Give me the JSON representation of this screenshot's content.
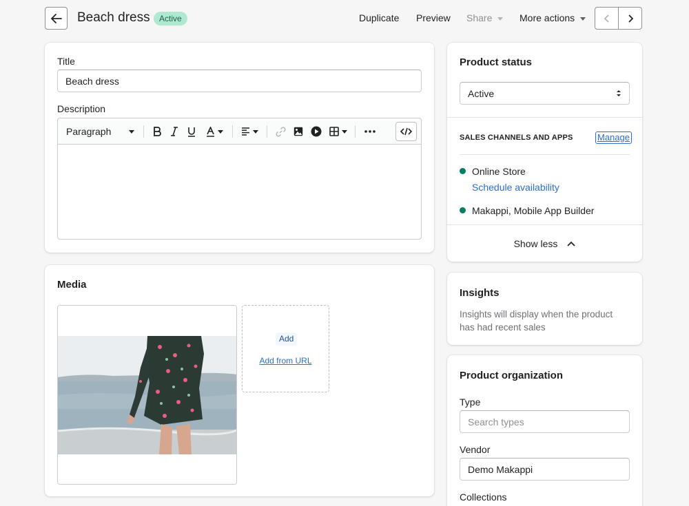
{
  "header": {
    "title": "Beach dress",
    "status_badge": "Active",
    "actions": {
      "duplicate": "Duplicate",
      "preview": "Preview",
      "share": "Share",
      "more": "More actions"
    }
  },
  "product_form": {
    "title_label": "Title",
    "title_value": "Beach dress",
    "description_label": "Description",
    "toolbar": {
      "paragraph": "Paragraph"
    }
  },
  "media": {
    "heading": "Media",
    "add_label": "Add",
    "add_url_label": "Add from URL"
  },
  "product_status": {
    "heading": "Product status",
    "selected": "Active",
    "channels_title": "SALES CHANNELS AND APPS",
    "manage_label": "Manage",
    "channels": [
      {
        "name": "Online Store",
        "sub_link": "Schedule availability"
      },
      {
        "name": "Makappi, Mobile App Builder"
      }
    ],
    "show_less": "Show less"
  },
  "insights": {
    "heading": "Insights",
    "text": "Insights will display when the product has had recent sales"
  },
  "organization": {
    "heading": "Product organization",
    "type_label": "Type",
    "type_placeholder": "Search types",
    "vendor_label": "Vendor",
    "vendor_value": "Demo Makappi",
    "collections_label": "Collections"
  },
  "colors": {
    "badge_bg": "#aee9d1",
    "channel_dot": "#007f5f",
    "link": "#2c6ecb"
  }
}
